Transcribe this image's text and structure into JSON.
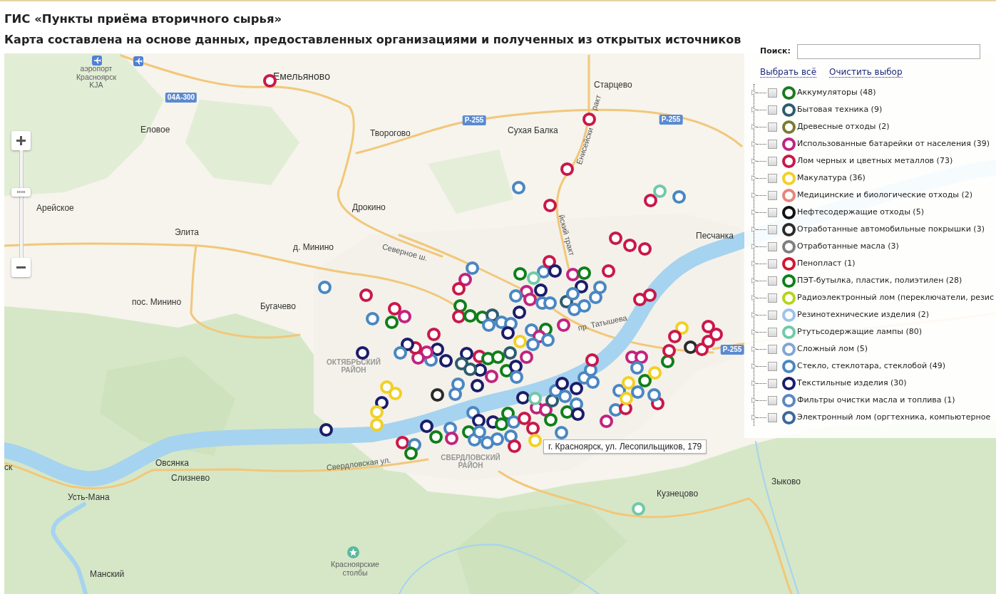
{
  "header": {
    "title": "ГИС «Пункты приёма вторичного сырья»",
    "subtitle": "Карта составлена на основе данных, предоставленных организациями и полученных из открытых источников"
  },
  "map": {
    "zoom": {
      "level": 0.61
    },
    "places": [
      {
        "name": "аэропорт Красноярск KJA",
        "kind": "poi"
      },
      {
        "name": "Емельяново",
        "kind": "major"
      },
      {
        "name": "Старцево",
        "kind": "town"
      },
      {
        "name": "ракт",
        "kind": "street"
      },
      {
        "name": "Еловое",
        "kind": "town"
      },
      {
        "name": "Творогово",
        "kind": "town"
      },
      {
        "name": "Сухая Балка",
        "kind": "town"
      },
      {
        "name": "Енисейски",
        "kind": "street"
      },
      {
        "name": "Арейское",
        "kind": "town"
      },
      {
        "name": "Дрокино",
        "kind": "town"
      },
      {
        "name": "Элита",
        "kind": "town"
      },
      {
        "name": "йский тракт",
        "kind": "street"
      },
      {
        "name": "Песчанка",
        "kind": "town"
      },
      {
        "name": "д. Минино",
        "kind": "town"
      },
      {
        "name": "Северное ш.",
        "kind": "street"
      },
      {
        "name": "пос. Минино",
        "kind": "town"
      },
      {
        "name": "Бугачево",
        "kind": "town"
      },
      {
        "name": "пр. Татышева",
        "kind": "street"
      },
      {
        "name": "ОКТЯБРЬСКИЙ РАЙОН",
        "kind": "district"
      },
      {
        "name": "ск",
        "kind": "town"
      },
      {
        "name": "Овсянка",
        "kind": "town"
      },
      {
        "name": "Свердловская ул.",
        "kind": "street"
      },
      {
        "name": "СВЕРДЛОВСКИЙ РАЙОН",
        "kind": "district"
      },
      {
        "name": "Слизнево",
        "kind": "town"
      },
      {
        "name": "Зыково",
        "kind": "town"
      },
      {
        "name": "Усть-Мана",
        "kind": "town"
      },
      {
        "name": "Кузнецово",
        "kind": "town"
      },
      {
        "name": "Манский",
        "kind": "town"
      },
      {
        "name": "Красноярские столбы",
        "kind": "poi"
      }
    ],
    "roads": [
      {
        "label": "04А-300"
      },
      {
        "label": "Р-255"
      },
      {
        "label": "Р-255"
      },
      {
        "label": "Р-255"
      }
    ],
    "markers": [
      {
        "color": "#c9184a"
      },
      {
        "color": "#c9184a"
      },
      {
        "color": "#c9184a"
      },
      {
        "color": "#4a87c2"
      },
      {
        "color": "#c9184a"
      },
      {
        "color": "#c9184a"
      },
      {
        "color": "#70c9a9"
      },
      {
        "color": "#4a87c2"
      },
      {
        "color": "#c9184a"
      },
      {
        "color": "#c9184a"
      },
      {
        "color": "#c9184a"
      },
      {
        "color": "#c9184a"
      },
      {
        "color": "#4a87c2"
      },
      {
        "color": "#c9184a"
      },
      {
        "color": "#4a87c2"
      },
      {
        "color": "#0f7f1a"
      },
      {
        "color": "#c9184a"
      },
      {
        "color": "#c2237f"
      },
      {
        "color": "#c9184a"
      },
      {
        "color": "#1c1c6b"
      },
      {
        "color": "#4a87c2"
      },
      {
        "color": "#c2237f"
      },
      {
        "color": "#c9184a"
      },
      {
        "color": "#0f7f1a"
      },
      {
        "color": "#c9184a"
      },
      {
        "color": "#0f7f1a"
      },
      {
        "color": "#0f7f1a"
      },
      {
        "color": "#2d5c6e"
      },
      {
        "color": "#4a87c2"
      },
      {
        "color": "#4a87c2"
      },
      {
        "color": "#4a87c2"
      },
      {
        "color": "#1c1c6b"
      },
      {
        "color": "#1c1c6b"
      },
      {
        "color": "#0f7f1a"
      },
      {
        "color": "#4a87c2"
      },
      {
        "color": "#70c9a9"
      },
      {
        "color": "#c9184a"
      },
      {
        "color": "#1c1c6b"
      },
      {
        "color": "#c2237f"
      },
      {
        "color": "#c2237f"
      },
      {
        "color": "#4a87c2"
      },
      {
        "color": "#1c1c6b"
      },
      {
        "color": "#4a87c2"
      },
      {
        "color": "#4a87c2"
      },
      {
        "color": "#2d5c6e"
      },
      {
        "color": "#c2237f"
      },
      {
        "color": "#0f7f1a"
      },
      {
        "color": "#1c1c6b"
      },
      {
        "color": "#4a87c2"
      },
      {
        "color": "#4a87c2"
      },
      {
        "color": "#4a87c2"
      },
      {
        "color": "#4a87c2"
      },
      {
        "color": "#4a87c2"
      },
      {
        "color": "#c9184a"
      },
      {
        "color": "#c9184a"
      },
      {
        "color": "#c2237f"
      },
      {
        "color": "#4a87c2"
      },
      {
        "color": "#0f7f1a"
      },
      {
        "color": "#c2237f"
      },
      {
        "color": "#4a87c2"
      },
      {
        "color": "#f2d024"
      },
      {
        "color": "#4a87c2"
      },
      {
        "color": "#c2237f"
      },
      {
        "color": "#0f7f1a"
      },
      {
        "color": "#1c1c6b"
      },
      {
        "color": "#4a87c2"
      },
      {
        "color": "#c2237f"
      },
      {
        "color": "#1c1c6b"
      },
      {
        "color": "#c9184a"
      },
      {
        "color": "#0f7f1a"
      },
      {
        "color": "#0f7f1a"
      },
      {
        "color": "#2d5c6e"
      },
      {
        "color": "#1c1c6b"
      },
      {
        "color": "#2d5c6e"
      },
      {
        "color": "#2d5c6e"
      },
      {
        "color": "#1c1c6b"
      },
      {
        "color": "#1c1c6b"
      },
      {
        "color": "#4a87c2"
      },
      {
        "color": "#c2237f"
      },
      {
        "color": "#c2237f"
      },
      {
        "color": "#c9184a"
      },
      {
        "color": "#1c1c6b"
      },
      {
        "color": "#4a87c2"
      },
      {
        "color": "#4a87c2"
      },
      {
        "color": "#4a87c2"
      },
      {
        "color": "#2b2b2b"
      },
      {
        "color": "#1c1c6b"
      },
      {
        "color": "#f2d024"
      },
      {
        "color": "#f2d024"
      },
      {
        "color": "#1c1c6b"
      },
      {
        "color": "#f2d024"
      },
      {
        "color": "#f2d024"
      },
      {
        "color": "#1c1c6b"
      },
      {
        "color": "#1c1c6b"
      },
      {
        "color": "#0f7f1a"
      },
      {
        "color": "#4a87c2"
      },
      {
        "color": "#c2237f"
      },
      {
        "color": "#c9184a"
      },
      {
        "color": "#4a87c2"
      },
      {
        "color": "#0f7f1a"
      },
      {
        "color": "#4a87c2"
      },
      {
        "color": "#1c1c6b"
      },
      {
        "color": "#0f7f1a"
      },
      {
        "color": "#4a87c2"
      },
      {
        "color": "#4a87c2"
      },
      {
        "color": "#4a87c2"
      },
      {
        "color": "#4a87c2"
      },
      {
        "color": "#1c1c6b"
      },
      {
        "color": "#0f7f1a"
      },
      {
        "color": "#0f7f1a"
      },
      {
        "color": "#4a87c2"
      },
      {
        "color": "#4a87c2"
      },
      {
        "color": "#c9184a"
      },
      {
        "color": "#c9184a"
      },
      {
        "color": "#c9184a"
      },
      {
        "color": "#4a87c2"
      },
      {
        "color": "#1c1c6b"
      },
      {
        "color": "#c2237f"
      },
      {
        "color": "#c2237f"
      },
      {
        "color": "#0f7f1a"
      },
      {
        "color": "#70c9a9"
      },
      {
        "color": "#2d5c6e"
      },
      {
        "color": "#4a87c2"
      },
      {
        "color": "#1c1c6b"
      },
      {
        "color": "#4a87c2"
      },
      {
        "color": "#0f7f1a"
      },
      {
        "color": "#4a87c2"
      },
      {
        "color": "#1c1c6b"
      },
      {
        "color": "#1c1c6b"
      },
      {
        "color": "#4a87c2"
      },
      {
        "color": "#4a87c2"
      },
      {
        "color": "#4a87c2"
      },
      {
        "color": "#c9184a"
      },
      {
        "color": "#c2237f"
      },
      {
        "color": "#4a87c2"
      },
      {
        "color": "#c9184a"
      },
      {
        "color": "#4a87c2"
      },
      {
        "color": "#f2d024"
      },
      {
        "color": "#f2d024"
      },
      {
        "color": "#4a87c2"
      },
      {
        "color": "#0f7f1a"
      },
      {
        "color": "#f2d024"
      },
      {
        "color": "#c9184a"
      },
      {
        "color": "#4a87c2"
      },
      {
        "color": "#c2237f"
      },
      {
        "color": "#c2237f"
      },
      {
        "color": "#4a87c2"
      },
      {
        "color": "#0f7f1a"
      },
      {
        "color": "#c9184a"
      },
      {
        "color": "#f2d024"
      },
      {
        "color": "#c9184a"
      },
      {
        "color": "#2b2b2b"
      },
      {
        "color": "#c9184a"
      },
      {
        "color": "#c9184a"
      },
      {
        "color": "#c9184a"
      },
      {
        "color": "#c9184a"
      },
      {
        "color": "#70c9a9"
      },
      {
        "color": "#f2d024"
      }
    ],
    "tooltip": "г. Красноярск, ул. Лесопильщиков, 179"
  },
  "legend": {
    "search": {
      "label": "Поиск:"
    },
    "actions": [
      {
        "label": "Выбрать всё"
      },
      {
        "label": "Очистить выбор"
      }
    ],
    "categories": [
      {
        "label": "Аккумуляторы (48)",
        "color": "#197a1f",
        "checked": false,
        "expanded": false
      },
      {
        "label": "Бытовая техника (9)",
        "color": "#2d5c6e",
        "checked": false,
        "expanded": false
      },
      {
        "label": "Древесные отходы (2)",
        "color": "#7b7b35",
        "checked": false,
        "expanded": false
      },
      {
        "label": "Использованные батарейки от населения (39)",
        "color": "#c2237f",
        "checked": false,
        "expanded": false
      },
      {
        "label": "Лом черных и цветных металлов (73)",
        "color": "#c9184a",
        "checked": false,
        "expanded": false
      },
      {
        "label": "Макулатура (36)",
        "color": "#f2d024",
        "checked": false,
        "expanded": false
      },
      {
        "label": "Медицинские и биологические отходы (2)",
        "color": "#e8857c",
        "checked": false,
        "expanded": false
      },
      {
        "label": "Нефтесодержащие отходы (5)",
        "color": "#111111",
        "checked": false,
        "expanded": false
      },
      {
        "label": "Отработанные автомобильные покрышки (3)",
        "color": "#2b2b2b",
        "checked": false,
        "expanded": false
      },
      {
        "label": "Отработанные масла (3)",
        "color": "#7f7f7f",
        "checked": false,
        "expanded": false
      },
      {
        "label": "Пенопласт (1)",
        "color": "#d4162f",
        "checked": false,
        "expanded": false
      },
      {
        "label": "ПЭТ-бутылка, пластик, полиэтилен (28)",
        "color": "#0f7f1a",
        "checked": false,
        "expanded": false
      },
      {
        "label": "Радиоэлектронный лом (переключатели, резис",
        "color": "#b6d41c",
        "checked": false,
        "expanded": false
      },
      {
        "label": "Резинотехнические изделия (2)",
        "color": "#9cc4ec",
        "checked": false,
        "expanded": false
      },
      {
        "label": "Ртутьсодержащие лампы (80)",
        "color": "#70c9a9",
        "checked": false,
        "expanded": false
      },
      {
        "label": "Сложный лом (5)",
        "color": "#7fa6d6",
        "checked": false,
        "expanded": false
      },
      {
        "label": "Стекло, стеклотара, стеклобой (49)",
        "color": "#4a87c2",
        "checked": false,
        "expanded": false
      },
      {
        "label": "Текстильные изделия (30)",
        "color": "#1c1c6b",
        "checked": false,
        "expanded": false
      },
      {
        "label": "Фильтры очистки масла и топлива (1)",
        "color": "#5d87c0",
        "checked": false,
        "expanded": false
      },
      {
        "label": "Электронный лом (оргтехника, компьютерное",
        "color": "#3d6899",
        "checked": false,
        "expanded": false
      }
    ]
  }
}
